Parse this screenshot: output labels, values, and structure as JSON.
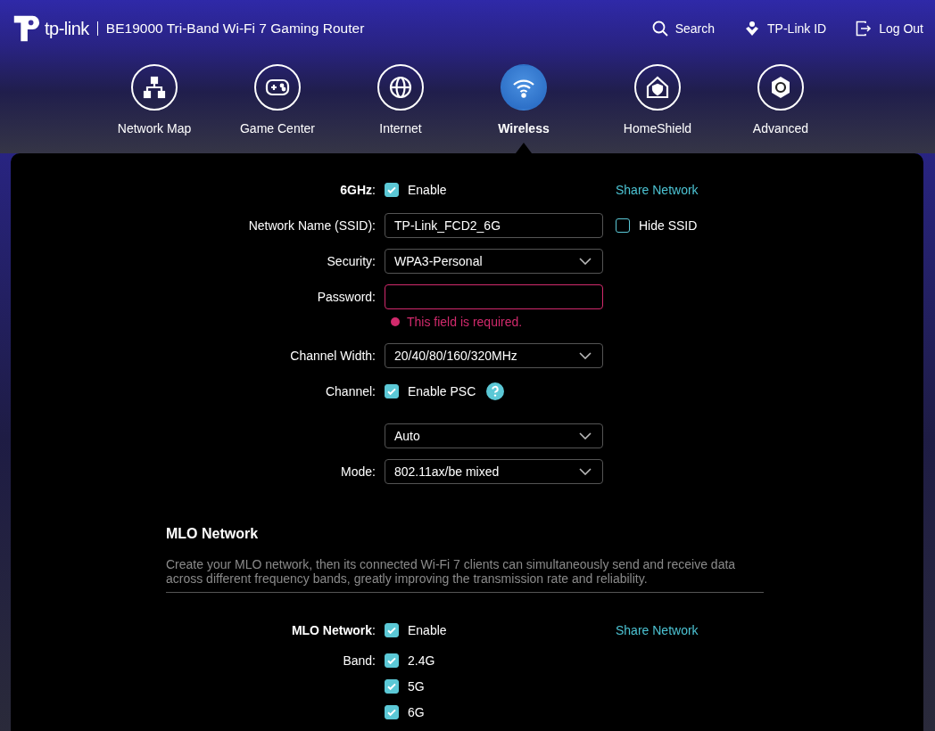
{
  "header": {
    "logo_text": "tp-link",
    "product": "BE19000 Tri-Band Wi-Fi 7 Gaming Router",
    "actions": [
      {
        "kind": "search",
        "label": "Search"
      },
      {
        "kind": "id",
        "label": "TP-Link ID"
      },
      {
        "kind": "logout",
        "label": "Log Out"
      }
    ]
  },
  "nav": [
    {
      "kind": "map",
      "label": "Network Map",
      "selected": false
    },
    {
      "kind": "game",
      "label": "Game Center",
      "selected": false
    },
    {
      "kind": "globe",
      "label": "Internet",
      "selected": false
    },
    {
      "kind": "wifi",
      "label": "Wireless",
      "selected": true
    },
    {
      "kind": "shield",
      "label": "HomeShield",
      "selected": false
    },
    {
      "kind": "gear",
      "label": "Advanced",
      "selected": false
    }
  ],
  "band_form": {
    "rows": [
      {
        "kind": "checkbox",
        "label": "**6GHz**:",
        "options": [
          {
            "label": "Enable",
            "checked": true
          }
        ],
        "link": "Share Network"
      },
      {
        "kind": "text",
        "label": "Network Name (SSID):",
        "value": "TP-Link_FCD2_6G",
        "extra": {
          "label": "Hide SSID",
          "checked": false
        }
      },
      {
        "kind": "select",
        "label": "Security:",
        "value": "WPA3-Personal"
      },
      {
        "kind": "password",
        "label": "Password:",
        "error": "This field is required."
      },
      {
        "kind": "select",
        "label": "Channel Width:",
        "value": "20/40/80/160/320MHz"
      },
      {
        "kind": "checkbox",
        "label": "Channel:",
        "options": [
          {
            "label": "Enable PSC",
            "checked": true
          }
        ],
        "help": true
      },
      {
        "kind": "select",
        "value": "Auto"
      },
      {
        "kind": "select",
        "label": "Mode:",
        "value": "802.11ax/be mixed"
      }
    ]
  },
  "mlo": {
    "title": "MLO Network",
    "description": "Create your MLO network, then its connected Wi-Fi 7 clients can simultaneously send and receive data across different frequency bands, greatly improving the transmission rate and reliability.",
    "rows": [
      {
        "kind": "checkbox",
        "label": "**MLO Network**:",
        "options": [
          {
            "label": "Enable",
            "checked": true
          }
        ],
        "link": "Share Network"
      },
      {
        "kind": "checkbox",
        "label": "Band:",
        "options": [
          {
            "label": "2.4G",
            "checked": true
          },
          {
            "label": "5G",
            "checked": true
          },
          {
            "label": "6G",
            "checked": true
          }
        ]
      }
    ]
  }
}
